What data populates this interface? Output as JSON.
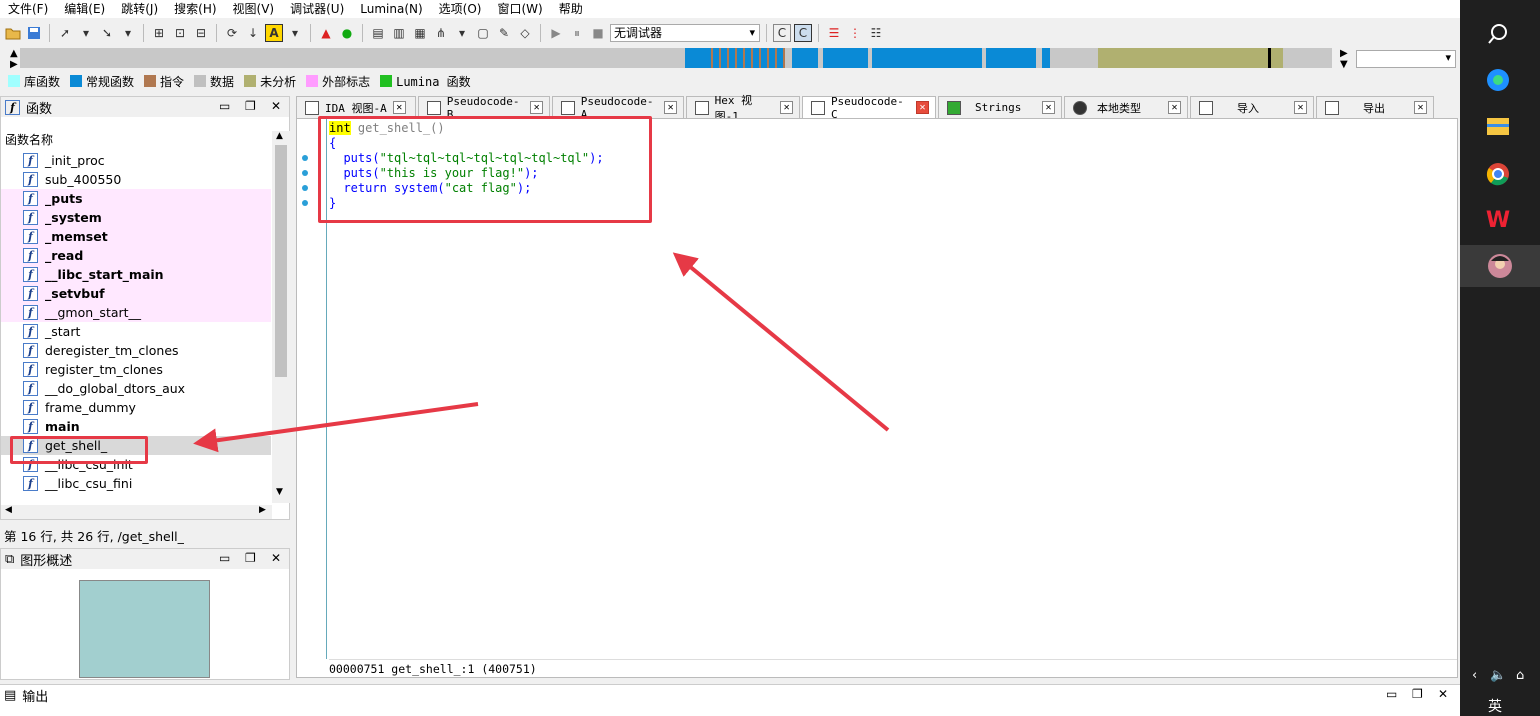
{
  "menu": [
    "文件(F)",
    "编辑(E)",
    "跳转(J)",
    "搜索(H)",
    "视图(V)",
    "调试器(U)",
    "Lumina(N)",
    "选项(O)",
    "窗口(W)",
    "帮助"
  ],
  "toolbar": {
    "debugger_value": "无调试器"
  },
  "legend": [
    {
      "label": "库函数",
      "color": "#a0ffff"
    },
    {
      "label": "常规函数",
      "color": "#0a8ad6"
    },
    {
      "label": "指令",
      "color": "#b07850"
    },
    {
      "label": "数据",
      "color": "#c0c0c0"
    },
    {
      "label": "未分析",
      "color": "#b0b070"
    },
    {
      "label": "外部标志",
      "color": "#ff9cff"
    },
    {
      "label": "Lumina 函数",
      "color": "#22c022"
    }
  ],
  "functions_panel": {
    "title": "函数",
    "column_header": "函数名称",
    "items": [
      {
        "name": "_init_proc",
        "kind": "normal"
      },
      {
        "name": "sub_400550",
        "kind": "normal"
      },
      {
        "name": "_puts",
        "kind": "import"
      },
      {
        "name": "_system",
        "kind": "import"
      },
      {
        "name": "_memset",
        "kind": "import"
      },
      {
        "name": "_read",
        "kind": "import"
      },
      {
        "name": "__libc_start_main",
        "kind": "import"
      },
      {
        "name": "_setvbuf",
        "kind": "import"
      },
      {
        "name": "__gmon_start__",
        "kind": "import-light"
      },
      {
        "name": "_start",
        "kind": "normal"
      },
      {
        "name": "deregister_tm_clones",
        "kind": "normal"
      },
      {
        "name": "register_tm_clones",
        "kind": "normal"
      },
      {
        "name": "__do_global_dtors_aux",
        "kind": "normal"
      },
      {
        "name": "frame_dummy",
        "kind": "normal"
      },
      {
        "name": "main",
        "kind": "bold"
      },
      {
        "name": "get_shell_",
        "kind": "selected"
      },
      {
        "name": "__libc_csu_init",
        "kind": "normal"
      },
      {
        "name": "__libc_csu_fini",
        "kind": "normal"
      }
    ],
    "status": "第 16 行, 共 26 行, /get_shell_"
  },
  "overview_panel": {
    "title": "图形概述"
  },
  "output_panel": {
    "title": "输出"
  },
  "tabs": [
    {
      "label": "IDA 视图-A",
      "active": false
    },
    {
      "label": "Pseudocode-B",
      "active": false
    },
    {
      "label": "Pseudocode-A",
      "active": false
    },
    {
      "label": "Hex 视图-1",
      "active": false
    },
    {
      "label": "Pseudocode-C",
      "active": true
    },
    {
      "label": "Strings",
      "active": false
    },
    {
      "label": "本地类型",
      "active": false
    },
    {
      "label": "导入",
      "active": false
    },
    {
      "label": "导出",
      "active": false
    }
  ],
  "code": {
    "line1_type": "int",
    "line1_name": " get_shell_()",
    "line2": "{",
    "line3_fn": "  puts(",
    "line3_str": "\"tql~tql~tql~tql~tql~tql~tql\"",
    "line3_end": ");",
    "line4_fn": "  puts(",
    "line4_str": "\"this is your flag!\"",
    "line4_end": ");",
    "line5_kw": "  return system(",
    "line5_str": "\"cat flag\"",
    "line5_end": ");",
    "line6": "}",
    "status": "00000751 get_shell_:1 (400751)"
  },
  "tray": {
    "ime": "英"
  },
  "icons": [
    "folder-icon",
    "save-icon",
    "search-icon",
    "edge-icon",
    "file-explorer-icon",
    "chrome-icon",
    "wps-icon",
    "avatar-icon"
  ]
}
